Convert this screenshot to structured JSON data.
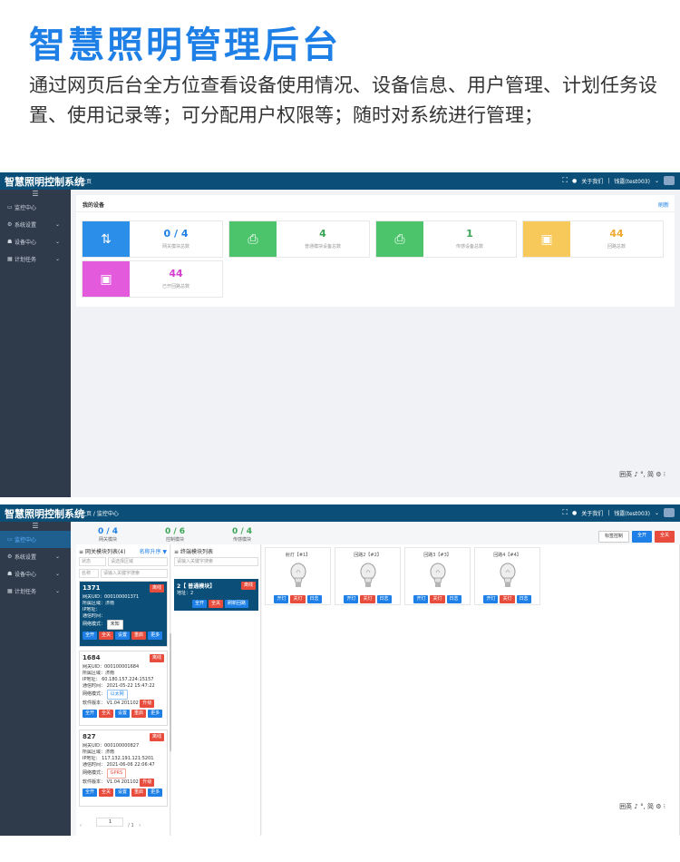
{
  "hero": {
    "title": "智慧照明管理后台",
    "desc": "通过网页后台全方位查看设备使用情况、设备信息、用户管理、计划任务设置、使用记录等；可分配用户权限等；随时对系统进行管理；"
  },
  "app": {
    "brand": "智慧照明控制系统",
    "about": "关于我们",
    "user": "钱露(test003)",
    "watermark": "囲英 ♪ °, 简 ⚙ ⁝"
  },
  "sidebar": {
    "items": [
      {
        "label": "监控中心"
      },
      {
        "label": "系统设置"
      },
      {
        "label": "设备中心"
      },
      {
        "label": "计划任务"
      }
    ]
  },
  "screen1": {
    "crumb": "主页",
    "panel_title": "我的设备",
    "refresh": "刷新",
    "stats": [
      {
        "value": "0 / 4",
        "label": "网关模块总数",
        "color": "#2b8ee8",
        "value_color": "#1e80e6"
      },
      {
        "value": "4",
        "label": "普通模块设备总数",
        "color": "#4cc46b",
        "value_color": "#3aa655"
      },
      {
        "value": "1",
        "label": "传感设备总数",
        "color": "#4cc46b",
        "value_color": "#3aa655"
      },
      {
        "value": "44",
        "label": "回路总数",
        "color": "#f7c85a",
        "value_color": "#f0a830"
      },
      {
        "value": "44",
        "label": "已开回路总数",
        "color": "#e35bdc",
        "value_color": "#d63fd0"
      }
    ]
  },
  "screen2": {
    "crumb": "主页 / 监控中心",
    "summary": [
      {
        "value": "0 / 4",
        "label": "网关模块",
        "color": "#1e80e6"
      },
      {
        "value": "0 / 6",
        "label": "控制模块",
        "color": "#3aa655"
      },
      {
        "value": "0 / 4",
        "label": "传感模块",
        "color": "#3aa655"
      }
    ],
    "top_buttons": {
      "label_ctrl": "标签控制",
      "all_on": "全开",
      "all_off": "全关"
    },
    "gateway_list": {
      "title": "网关模块列表(4)",
      "sort": "名称升序 ▼",
      "filter_status": "状态",
      "filter_area": "请选择区域",
      "filter_type": "名称",
      "filter_keyword": "请输入关键字搜索"
    },
    "gateways": [
      {
        "name": "1371",
        "status": "离线",
        "uid": "网关UID：000100001371",
        "area": "所属区域：济南",
        "ip": "IP地址：",
        "time": "通信时间：",
        "mode_label": "网络模式：",
        "mode": "未知",
        "version": ""
      },
      {
        "name": "1684",
        "status": "离线",
        "uid": "网关UID：000100001684",
        "area": "所属区域：济南",
        "ip": "IP地址：   60.180.157.224:15157",
        "time": "通信时间：   2021-05-22 15:47:22",
        "mode_label": "网络模式：",
        "mode": "以太网",
        "version": "软件版本：  V1.04 201102",
        "upgrade": "升级"
      },
      {
        "name": "827",
        "status": "离线",
        "uid": "网关UID：000100000827",
        "area": "所属区域：济南",
        "ip": "IP地址：   117.132.191.121:5201",
        "time": "通信时间：   2021-06-06 22:06:47",
        "mode_label": "网络模式：",
        "mode": "GPRS",
        "version": "软件版本：  V1.04 201102",
        "upgrade": "升级"
      }
    ],
    "gateway_actions": [
      "全开",
      "全关",
      "设置",
      "重启",
      "更多"
    ],
    "pager": {
      "page": "1",
      "total": "/ 1"
    },
    "module_list": {
      "title": "终端模块列表",
      "search": "请输入关键字搜索"
    },
    "module": {
      "title": "2【 普通模块】",
      "sub": "地址：2",
      "status": "离线",
      "actions": [
        "全开",
        "全关",
        "刷新回路"
      ]
    },
    "loops": [
      {
        "title": "射灯【#1】"
      },
      {
        "title": "回路2【#2】"
      },
      {
        "title": "回路3【#3】"
      },
      {
        "title": "回路4【#4】"
      }
    ],
    "loop_actions": [
      "开灯",
      "关灯",
      "日志"
    ]
  }
}
